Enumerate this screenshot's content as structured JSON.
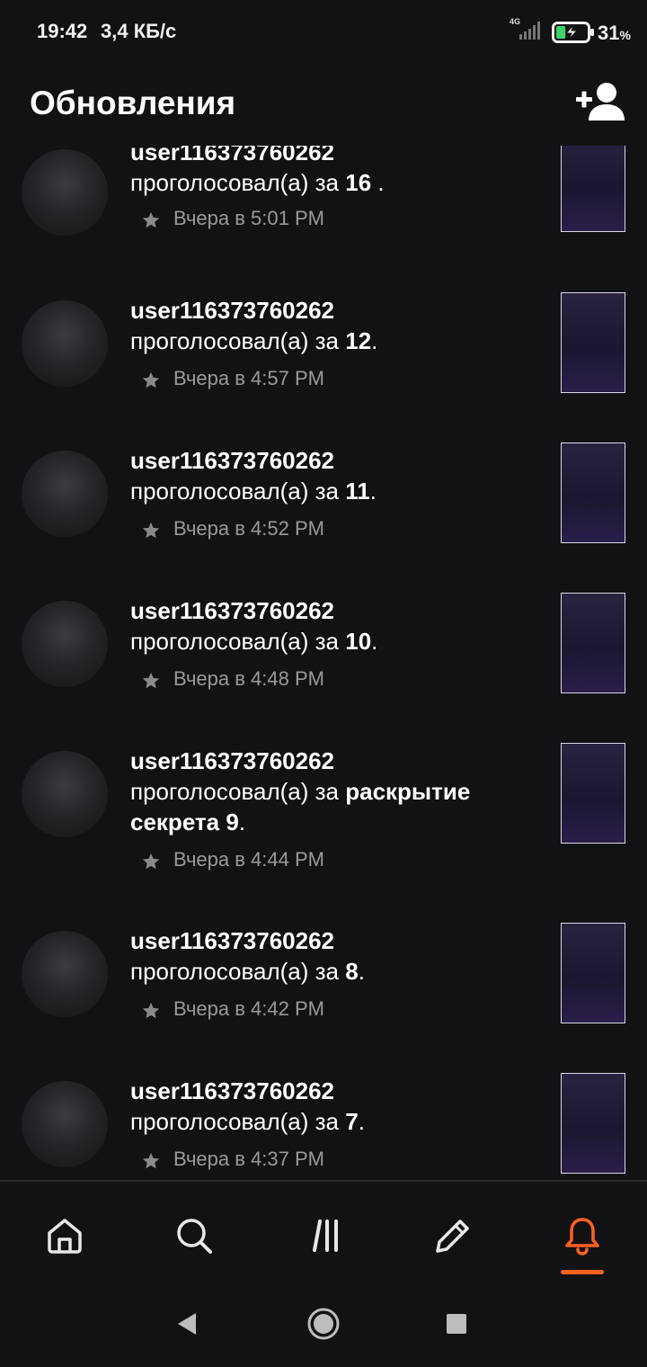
{
  "status_bar": {
    "time": "19:42",
    "speed": "3,4 КБ/с",
    "network": "4G",
    "battery_percent": "31",
    "battery_unit": "%",
    "battery_level": 0.31
  },
  "header": {
    "title": "Обновления",
    "add_user_icon": "add-user-icon"
  },
  "feed": {
    "items": [
      {
        "username": "user116373760262",
        "action": "проголосовал(а) за ",
        "target": "16",
        "suffix": " .",
        "time": "Вчера в 5:01 PM"
      },
      {
        "username": "user116373760262",
        "action": "проголосовал(а) за ",
        "target": "12",
        "suffix": ".",
        "time": "Вчера в 4:57 PM"
      },
      {
        "username": "user116373760262",
        "action": "проголосовал(а) за ",
        "target": "11",
        "suffix": ".",
        "time": "Вчера в 4:52 PM"
      },
      {
        "username": "user116373760262",
        "action": "проголосовал(а) за ",
        "target": "10",
        "suffix": ".",
        "time": "Вчера в 4:48 PM"
      },
      {
        "username": "user116373760262",
        "action": "проголосовал(а) за ",
        "target": "раскрытие секрета 9",
        "suffix": ".",
        "time": "Вчера в 4:44 PM"
      },
      {
        "username": "user116373760262",
        "action": "проголосовал(а) за ",
        "target": "8",
        "suffix": ".",
        "time": "Вчера в 4:42 PM"
      },
      {
        "username": "user116373760262",
        "action": "проголосовал(а) за ",
        "target": "7",
        "suffix": ".",
        "time": "Вчера в 4:37 PM"
      }
    ]
  },
  "bottom_nav": {
    "items": [
      {
        "icon": "home-icon",
        "active": false
      },
      {
        "icon": "search-icon",
        "active": false
      },
      {
        "icon": "library-icon",
        "active": false
      },
      {
        "icon": "pencil-icon",
        "active": false
      },
      {
        "icon": "bell-icon",
        "active": true
      }
    ],
    "accent_color": "#ff6122"
  },
  "system_nav": {
    "items": [
      {
        "icon": "back-icon"
      },
      {
        "icon": "home-circle-icon"
      },
      {
        "icon": "recents-icon"
      }
    ]
  },
  "colors": {
    "background": "#121114",
    "text_primary": "#ffffff",
    "text_secondary": "#9a9a9a",
    "accent": "#ff6122"
  }
}
